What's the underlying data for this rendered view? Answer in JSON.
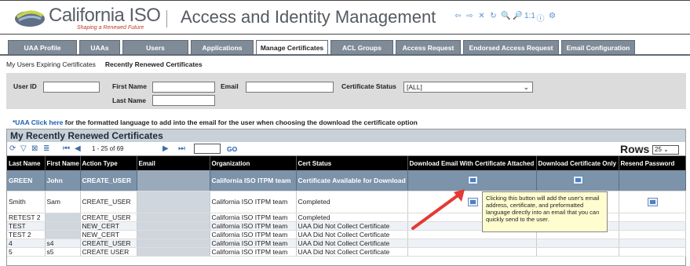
{
  "header": {
    "logo_name": "California ISO",
    "logo_tagline": "Shaping a Renewed Future",
    "app_title": "Access and Identity Management",
    "tool_icons": [
      "back-icon",
      "forward-icon",
      "close-icon",
      "refresh-icon",
      "zoom-out-icon",
      "zoom-in-icon",
      "actual-size-icon",
      "help-icon",
      "audit-icon"
    ],
    "tool_glyphs": [
      "⇦",
      "⇨",
      "✕",
      "↻",
      "🔍",
      "🔎",
      "1:1",
      "ⓘ",
      "⚙"
    ]
  },
  "tabs": [
    {
      "label": "UAA Profile"
    },
    {
      "label": "UAAs"
    },
    {
      "label": "Users"
    },
    {
      "label": "Applications"
    },
    {
      "label": "Manage Certificates",
      "active": true
    },
    {
      "label": "ACL Groups"
    },
    {
      "label": "Access Request"
    },
    {
      "label": "Endorsed Access Request"
    },
    {
      "label": "Email Configuration"
    }
  ],
  "subnav": {
    "expiring": "My Users Expiring Certificates",
    "renewed": "Recently Renewed Certificates"
  },
  "filters": {
    "user_id_label": "User ID",
    "first_name_label": "First Name",
    "last_name_label": "Last Name",
    "email_label": "Email",
    "cert_status_label": "Certificate Status",
    "cert_status_value": "[ALL]"
  },
  "info": {
    "link_text": "*UAA Click here",
    "rest_text": " for the formatted language to add into the email for the user when choosing the download the certificate option"
  },
  "grid": {
    "title": "My Recently Renewed Certificates",
    "pager_text": "1 - 25 of 69",
    "go_label": "GO",
    "rows_label": "Rows",
    "rows_value": "25",
    "columns": [
      "Last Name",
      "First Name",
      "Action Type",
      "Email",
      "Organization",
      "Cert Status",
      "Download Email With Certificate Attached",
      "Download Certificate Only",
      "Resend Password"
    ],
    "rows": [
      {
        "last": "GREEN",
        "first": "John",
        "action": "CREATE_USER",
        "email": "",
        "org": "California ISO ITPM team",
        "status": "Certificate Available for Download",
        "dl_email": true,
        "dl_cert": true,
        "resend": false
      },
      {
        "last": "Smith",
        "first": "Sam",
        "action": "CREATE_USER",
        "email": "",
        "org": "California ISO ITPM team",
        "status": "Completed",
        "dl_email": true,
        "dl_cert": false,
        "resend": true
      },
      {
        "last": "RETEST 2",
        "first": "",
        "action": "CREATE_USER",
        "email": "",
        "org": "California ISO ITPM team",
        "status": "Completed",
        "dl_email": false,
        "dl_cert": false,
        "resend": false
      },
      {
        "last": "TEST",
        "first": "",
        "action": "NEW_CERT",
        "email": "",
        "org": "California ISO ITPM team",
        "status": "UAA Did Not Collect Certificate",
        "dl_email": false,
        "dl_cert": false,
        "resend": false
      },
      {
        "last": "TEST 2",
        "first": "",
        "action": "NEW_CERT",
        "email": "",
        "org": "California ISO ITPM team",
        "status": "UAA Did Not Collect Certificate",
        "dl_email": false,
        "dl_cert": false,
        "resend": false
      },
      {
        "last": "4",
        "first": "s4",
        "action": "CREATE_USER",
        "email": "",
        "org": "California ISO ITPM team",
        "status": "UAA Did Not Collect Certificate",
        "dl_email": false,
        "dl_cert": false,
        "resend": false
      },
      {
        "last": "5",
        "first": "s5",
        "action": "CREATE USER",
        "email": "",
        "org": "California ISO ITPM team",
        "status": "UAA Did Not Collect Certificate",
        "dl_email": false,
        "dl_cert": false,
        "resend": false
      }
    ]
  },
  "tooltip": {
    "text": "Clicking this button will add the user's email address, certificate, and preformatted language directly into an email that you can quickly send to the user."
  }
}
